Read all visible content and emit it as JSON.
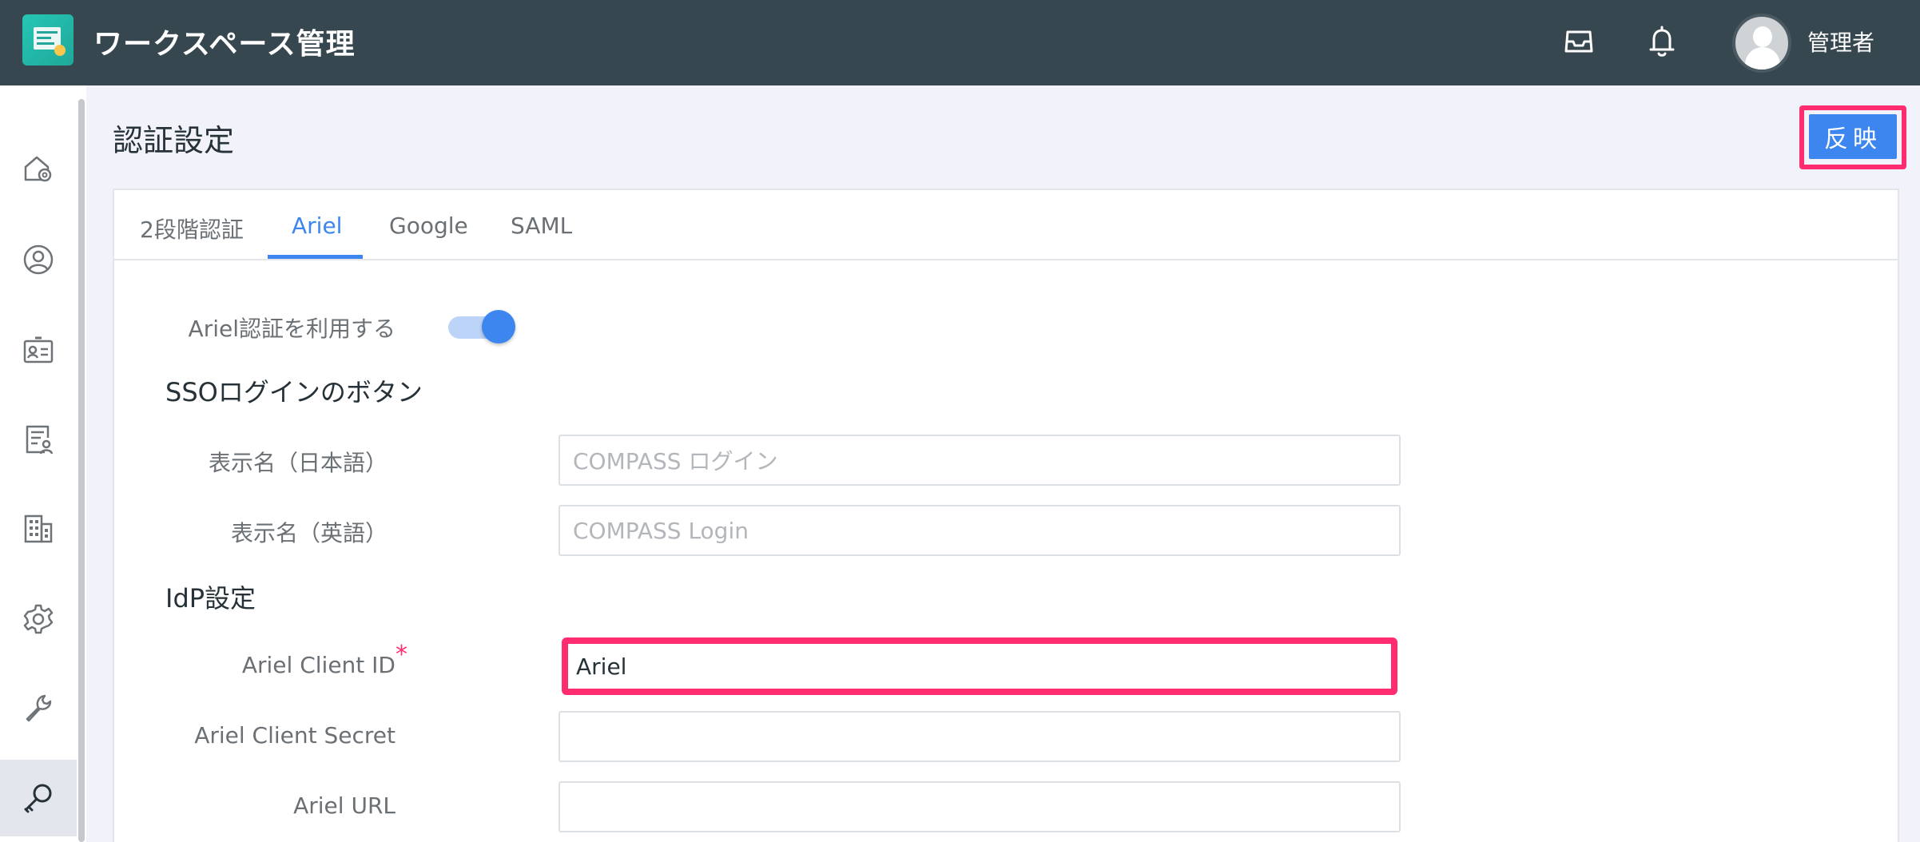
{
  "header": {
    "app_title": "ワークスペース管理",
    "user_name": "管理者",
    "icons": [
      "inbox-icon",
      "bell-icon",
      "avatar"
    ]
  },
  "sidebar": {
    "items": [
      {
        "icon": "home-settings-icon"
      },
      {
        "icon": "user-circle-icon"
      },
      {
        "icon": "id-card-icon"
      },
      {
        "icon": "document-user-icon"
      },
      {
        "icon": "building-icon"
      },
      {
        "icon": "gear-icon"
      },
      {
        "icon": "wrench-icon"
      },
      {
        "icon": "key-icon",
        "active": true
      }
    ]
  },
  "page": {
    "title": "認証設定",
    "apply_label": "反映"
  },
  "tabs": [
    {
      "label": "2段階認証"
    },
    {
      "label": "Ariel",
      "active": true
    },
    {
      "label": "Google"
    },
    {
      "label": "SAML"
    }
  ],
  "form": {
    "toggle_label": "Ariel認証を利用する",
    "toggle_on": true,
    "sso_section": "SSOログインのボタン",
    "display_name_ja_label": "表示名（日本語）",
    "display_name_ja_placeholder": "COMPASS ログイン",
    "display_name_en_label": "表示名（英語）",
    "display_name_en_placeholder": "COMPASS Login",
    "idp_section": "IdP設定",
    "client_id_label": "Ariel Client ID",
    "client_id_required": "*",
    "client_id_value": "Ariel",
    "client_secret_label": "Ariel Client Secret",
    "client_secret_value": "",
    "url_label": "Ariel URL",
    "url_value": ""
  },
  "colors": {
    "header_bg": "#37474f",
    "accent": "#3d86f0",
    "highlight": "#ff2d6f",
    "page_bg": "#f2f3fa"
  }
}
